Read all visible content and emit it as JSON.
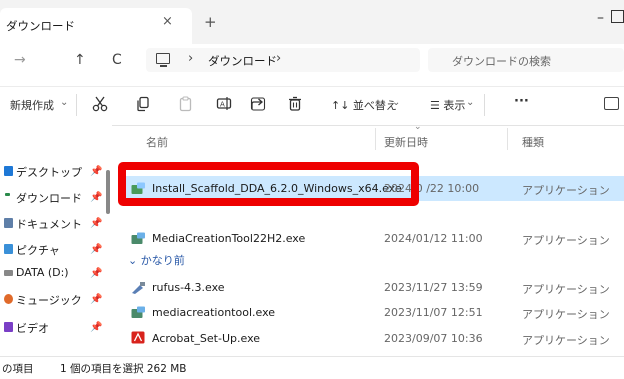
{
  "window": {
    "tab_title": "ダウンロード",
    "tab_close": "×",
    "new_tab": "+",
    "minimize": "–"
  },
  "nav": {
    "forward": "→",
    "up": "↑",
    "refresh": "C",
    "chevron": "›"
  },
  "address": {
    "folder": "ダウンロード",
    "chevron_after": "›"
  },
  "search": {
    "placeholder": "ダウンロードの検索"
  },
  "commands": {
    "new_label": "新規作成",
    "new_chevron": "⌄",
    "sort_label": "↑↓ 並べ替え",
    "sort_chevron": "⌄",
    "view_label": "☰ 表示",
    "view_chevron": "⌄",
    "more": "···",
    "cut_icon": "cut-icon",
    "copy_icon": "copy-icon",
    "paste_icon": "paste-icon",
    "rename_icon": "rename-icon",
    "share_icon": "share-icon",
    "delete_icon": "delete-icon"
  },
  "sidebar": {
    "pin_glyph": "📌",
    "items": [
      {
        "label": "デスクトップ",
        "color": "#1e78d6"
      },
      {
        "label": "ダウンロード",
        "color": "#2a8a4a"
      },
      {
        "label": "ドキュメント",
        "color": "#5f7fa8"
      },
      {
        "label": "ピクチャ",
        "color": "#3a90d8"
      },
      {
        "label": "DATA (D:)",
        "color": "#888888"
      },
      {
        "label": "ミュージック",
        "color": "#e06a2a"
      },
      {
        "label": "ビデオ",
        "color": "#7a3fc6"
      }
    ]
  },
  "columns": {
    "name": "名前",
    "date": "更新日時",
    "type": "種類",
    "sort_caret": "⌄"
  },
  "files": [
    {
      "name": "Install_Scaffold_DDA_6.2.0_Windows_x64.exe",
      "date": "2024/0 /22 10:00",
      "type": "アプリケーション",
      "selected": true
    },
    {
      "name": "MediaCreationTool22H2.exe",
      "date": "2024/01/12 11:00",
      "type": "アプリケーション"
    },
    {
      "name": "rufus-4.3.exe",
      "date": "2023/11/27 13:59",
      "type": "アプリケーション"
    },
    {
      "name": "mediacreationtool.exe",
      "date": "2023/11/07 12:51",
      "type": "アプリケーション"
    },
    {
      "name": "Acrobat_Set-Up.exe",
      "date": "2023/09/07 10:36",
      "type": "アプリケーション"
    }
  ],
  "groups": {
    "long_ago": "⌄ かなり前"
  },
  "status": {
    "items": "の項目",
    "selection": "1 個の項目を選択  262 MB"
  },
  "colors": {
    "selection": "#cce8ff",
    "highlight_box": "#ee0000",
    "accent": "#2b5aa8"
  }
}
